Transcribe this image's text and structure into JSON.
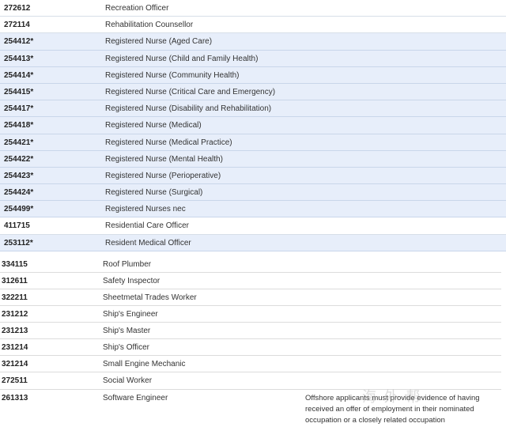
{
  "upper_rows": [
    {
      "code": "272612",
      "name": "Recreation Officer",
      "highlight": false
    },
    {
      "code": "272114",
      "name": "Rehabilitation Counsellor",
      "highlight": false
    },
    {
      "code": "254412*",
      "name": "Registered Nurse (Aged Care)",
      "highlight": true
    },
    {
      "code": "254413*",
      "name": "Registered Nurse (Child and Family Health)",
      "highlight": true
    },
    {
      "code": "254414*",
      "name": "Registered Nurse (Community Health)",
      "highlight": true
    },
    {
      "code": "254415*",
      "name": "Registered Nurse (Critical Care and Emergency)",
      "highlight": true
    },
    {
      "code": "254417*",
      "name": "Registered Nurse (Disability and Rehabilitation)",
      "highlight": true
    },
    {
      "code": "254418*",
      "name": "Registered Nurse (Medical)",
      "highlight": true
    },
    {
      "code": "254421*",
      "name": "Registered Nurse (Medical Practice)",
      "highlight": true
    },
    {
      "code": "254422*",
      "name": "Registered Nurse (Mental Health)",
      "highlight": true
    },
    {
      "code": "254423*",
      "name": "Registered Nurse (Perioperative)",
      "highlight": true
    },
    {
      "code": "254424*",
      "name": "Registered Nurse (Surgical)",
      "highlight": true
    },
    {
      "code": "254499*",
      "name": "Registered Nurses nec",
      "highlight": true
    },
    {
      "code": "411715",
      "name": "Residential Care Officer",
      "highlight": false
    },
    {
      "code": "253112*",
      "name": "Resident Medical Officer",
      "highlight": true
    }
  ],
  "lower_rows": [
    {
      "code": "334115",
      "name": "Roof Plumber"
    },
    {
      "code": "312611",
      "name": "Safety Inspector"
    },
    {
      "code": "322211",
      "name": "Sheetmetal Trades Worker"
    },
    {
      "code": "231212",
      "name": "Ship's Engineer"
    },
    {
      "code": "231213",
      "name": "Ship's Master"
    },
    {
      "code": "231214",
      "name": "Ship's Officer"
    },
    {
      "code": "321214",
      "name": "Small Engine Mechanic"
    },
    {
      "code": "272511",
      "name": "Social Worker"
    }
  ],
  "last_row": {
    "code": "261313",
    "name": "Software Engineer",
    "note": "Offshore applicants must provide evidence of having received an offer of employment in their nominated occupation or a closely related occupation"
  },
  "colors": {
    "highlight": "#e7eefa",
    "row_border": "#d7dfe8"
  }
}
